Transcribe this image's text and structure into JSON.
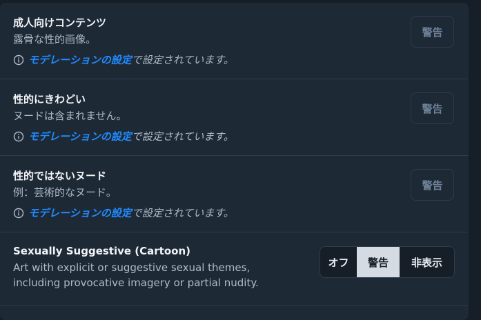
{
  "rows": [
    {
      "title": "成人向けコンテンツ",
      "description": "露骨な性的画像。",
      "note_link": "モデレーションの設定",
      "note_suffix": "で設定されています。",
      "button_label": "警告"
    },
    {
      "title": "性的にきわどい",
      "description": "ヌードは含まれません。",
      "note_link": "モデレーションの設定",
      "note_suffix": "で設定されています。",
      "button_label": "警告"
    },
    {
      "title": "性的ではないヌード",
      "description": "例：芸術的なヌード。",
      "note_link": "モデレーションの設定",
      "note_suffix": "で設定されています。",
      "button_label": "警告"
    }
  ],
  "cartoon": {
    "title": "Sexually Suggestive (Cartoon)",
    "description_line1": "Art with explicit or suggestive sexual themes,",
    "description_line2": "including provocative imagery or partial nudity.",
    "options": [
      "オフ",
      "警告",
      "非表示"
    ],
    "selected": "警告"
  },
  "colors": {
    "background": "#161e27",
    "panel": "#1e2936",
    "link": "#208bfe",
    "selected_segment": "#d4dbe2"
  },
  "icons": [
    "info-circle-icon"
  ]
}
